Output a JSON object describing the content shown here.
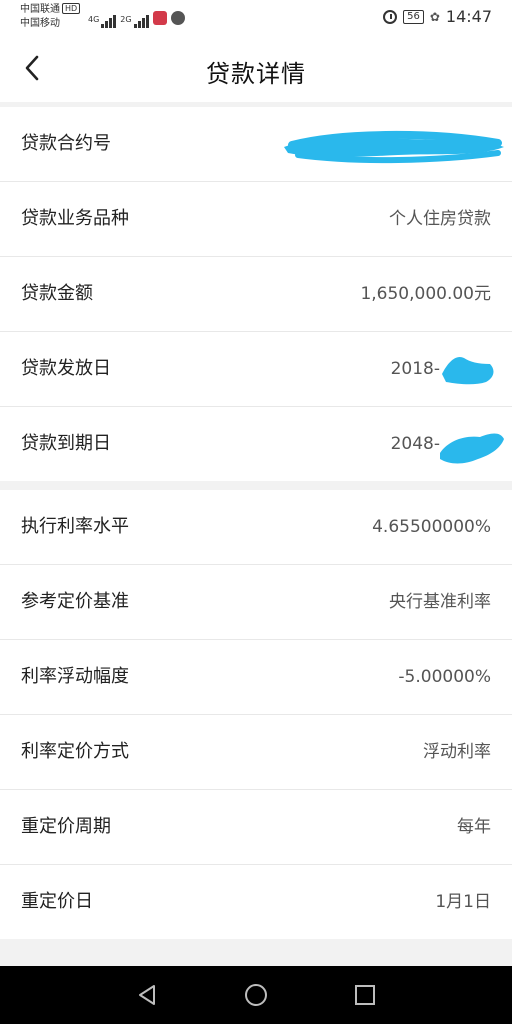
{
  "status_bar": {
    "carrier_1": "中国联通",
    "carrier_1_badge": "HD",
    "carrier_2": "中国移动",
    "network_1": "4G",
    "network_2": "2G",
    "battery": "56",
    "time": "14:47"
  },
  "header": {
    "title": "贷款详情",
    "back_icon": "chevron-left-icon"
  },
  "loan_info": [
    {
      "label": "贷款合约号",
      "value": ""
    },
    {
      "label": "贷款业务品种",
      "value": "个人住房贷款"
    },
    {
      "label": "贷款金额",
      "value": "1,650,000.00元"
    },
    {
      "label": "贷款发放日",
      "value": "2018-"
    },
    {
      "label": "贷款到期日",
      "value": "2048-"
    }
  ],
  "rate_info": [
    {
      "label": "执行利率水平",
      "value": "4.65500000%"
    },
    {
      "label": "参考定价基准",
      "value": "央行基准利率"
    },
    {
      "label": "利率浮动幅度",
      "value": "-5.00000%"
    },
    {
      "label": "利率定价方式",
      "value": "浮动利率"
    },
    {
      "label": "重定价周期",
      "value": "每年"
    },
    {
      "label": "重定价日",
      "value": "1月1日"
    }
  ],
  "nav_bar": {
    "icons": [
      "back-triangle-icon",
      "home-circle-icon",
      "recents-square-icon"
    ]
  },
  "colors": {
    "redaction": "#2ab8ec",
    "background": "#f2f2f2",
    "card": "#ffffff"
  }
}
